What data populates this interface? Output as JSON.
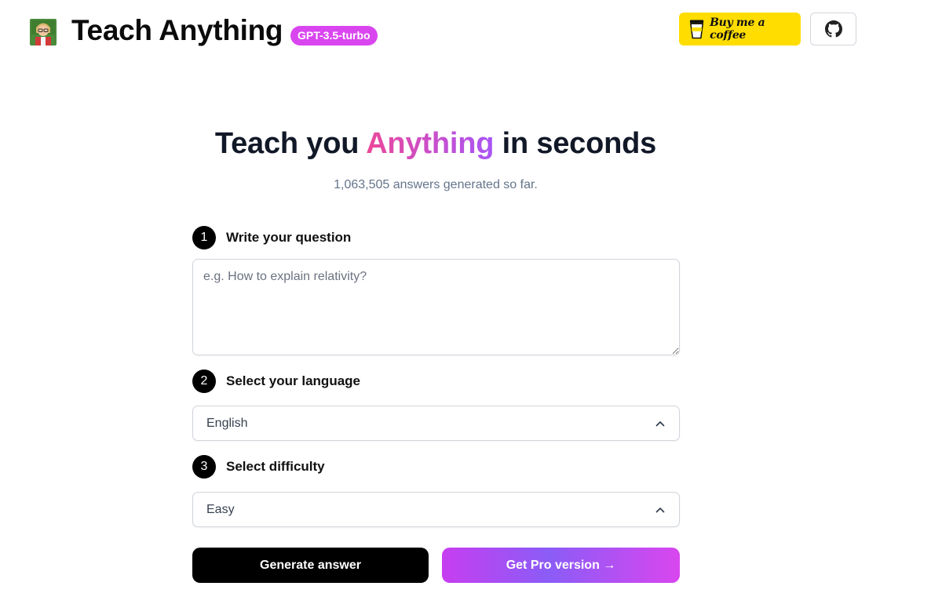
{
  "header": {
    "logo_icon": "teacher-avatar-icon",
    "brand": "Teach Anything",
    "model_badge": "GPT-3.5-turbo",
    "coffee_label": "Buy me a coffee",
    "coffee_icon": "coffee-cup-icon",
    "github_icon": "github-icon"
  },
  "hero": {
    "title_prefix": "Teach you ",
    "title_highlight": "Anything",
    "title_suffix": " in seconds",
    "counter": "1,063,505 answers generated so far."
  },
  "steps": [
    {
      "number": "1",
      "label": "Write your question"
    },
    {
      "number": "2",
      "label": "Select your language"
    },
    {
      "number": "3",
      "label": "Select difficulty"
    }
  ],
  "form": {
    "question_placeholder": "e.g. How to explain relativity?",
    "question_value": "",
    "language_value": "English",
    "difficulty_value": "Easy"
  },
  "actions": {
    "generate_label": "Generate answer",
    "pro_label": "Get Pro version →"
  },
  "colors": {
    "badge": "#d946ef",
    "coffee_button": "#ffdd00",
    "gradient_start": "#ec4899",
    "gradient_end": "#a855f7"
  }
}
